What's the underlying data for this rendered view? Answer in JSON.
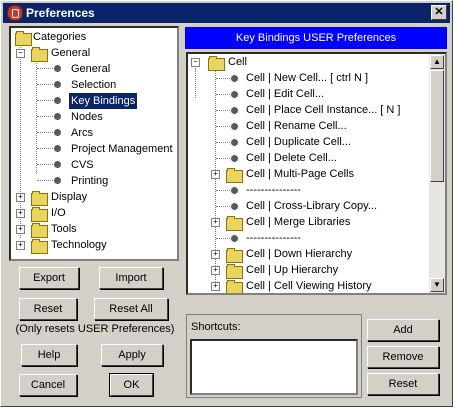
{
  "window": {
    "title": "Preferences",
    "close_label": "✕"
  },
  "left_tree": {
    "items": [
      {
        "label": "Categories"
      },
      {
        "label": "General"
      },
      {
        "label": "General"
      },
      {
        "label": "Selection"
      },
      {
        "label": "Key Bindings"
      },
      {
        "label": "Nodes"
      },
      {
        "label": "Arcs"
      },
      {
        "label": "Project Management"
      },
      {
        "label": "CVS"
      },
      {
        "label": "Printing"
      },
      {
        "label": "Display"
      },
      {
        "label": "I/O"
      },
      {
        "label": "Tools"
      },
      {
        "label": "Technology"
      }
    ]
  },
  "left_buttons": {
    "export": "Export",
    "import": "Import",
    "reset": "Reset",
    "reset_all": "Reset All",
    "note": "(Only resets USER Preferences)",
    "help": "Help",
    "apply": "Apply",
    "cancel": "Cancel",
    "ok": "OK"
  },
  "right_panel": {
    "header": "Key Bindings USER Preferences",
    "tree": [
      {
        "label": "Cell"
      },
      {
        "label": "Cell | New Cell...   [ ctrl N ]"
      },
      {
        "label": "Cell | Edit Cell..."
      },
      {
        "label": "Cell | Place Cell Instance...   [ N ]"
      },
      {
        "label": "Cell | Rename Cell..."
      },
      {
        "label": "Cell | Duplicate Cell..."
      },
      {
        "label": "Cell | Delete Cell..."
      },
      {
        "label": "Cell | Multi-Page Cells"
      },
      {
        "label": "---------------"
      },
      {
        "label": "Cell | Cross-Library Copy..."
      },
      {
        "label": "Cell | Merge Libraries"
      },
      {
        "label": "---------------"
      },
      {
        "label": "Cell | Down Hierarchy"
      },
      {
        "label": "Cell | Up Hierarchy"
      },
      {
        "label": "Cell | Cell Viewing History"
      }
    ],
    "shortcuts_label": "Shortcuts:",
    "add": "Add",
    "remove": "Remove",
    "reset": "Reset"
  }
}
